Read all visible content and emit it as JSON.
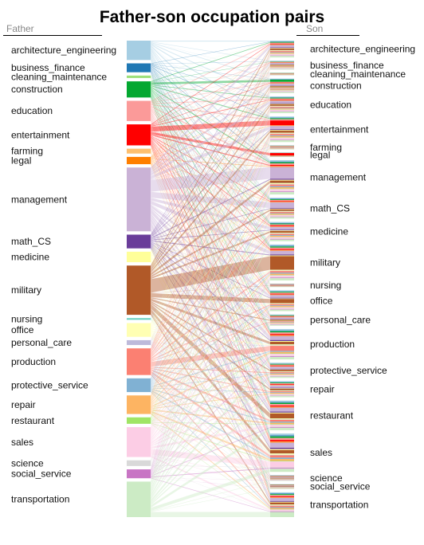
{
  "chart_data": {
    "type": "parallel_sets",
    "title": "Father-son occupation pairs",
    "left_axis_label": "Father",
    "right_axis_label": "Son",
    "categories": [
      {
        "name": "architecture_engineering",
        "color": "#a6cee3",
        "father": 24,
        "son": 21
      },
      {
        "name": "business_finance",
        "color": "#1f78b4",
        "father": 11,
        "son": 11
      },
      {
        "name": "cleaning_maintenance",
        "color": "#9de07a",
        "father": 3,
        "son": 3
      },
      {
        "name": "construction",
        "color": "#03a831",
        "father": 20,
        "son": 18
      },
      {
        "name": "education",
        "color": "#fb9a99",
        "father": 25,
        "son": 21
      },
      {
        "name": "entertainment",
        "color": "#ff0000",
        "father": 26,
        "son": 32
      },
      {
        "name": "farming",
        "color": "#fdbf6f",
        "father": 6,
        "son": 5
      },
      {
        "name": "legal",
        "color": "#ff7f00",
        "father": 9,
        "son": 5
      },
      {
        "name": "management",
        "color": "#cab2d6",
        "father": 79,
        "son": 43
      },
      {
        "name": "math_CS",
        "color": "#6a3d9a",
        "father": 17,
        "son": 26
      },
      {
        "name": "medicine",
        "color": "#ffff99",
        "father": 13,
        "son": 24
      },
      {
        "name": "military",
        "color": "#b15928",
        "father": 61,
        "son": 45
      },
      {
        "name": "nursing",
        "color": "#66d1c0",
        "father": 2,
        "son": 4
      },
      {
        "name": "office",
        "color": "#ffffb3",
        "father": 17,
        "son": 26
      },
      {
        "name": "personal_care",
        "color": "#bebada",
        "father": 6,
        "son": 14
      },
      {
        "name": "production",
        "color": "#fb8072",
        "father": 33,
        "son": 38
      },
      {
        "name": "protective_service",
        "color": "#80b1d3",
        "father": 17,
        "son": 19
      },
      {
        "name": "repair",
        "color": "#fdb462",
        "father": 23,
        "son": 20
      },
      {
        "name": "restaurant",
        "color": "#a0e565",
        "father": 8,
        "son": 37
      },
      {
        "name": "sales",
        "color": "#fccde5",
        "father": 37,
        "son": 48
      },
      {
        "name": "science",
        "color": "#d9d9d9",
        "father": 7,
        "son": 7
      },
      {
        "name": "social_service",
        "color": "#c875c4",
        "father": 11,
        "son": 6
      },
      {
        "name": "transportation",
        "color": "#ccebc5",
        "father": 44,
        "son": 31
      }
    ],
    "notable_flows": [
      {
        "father": "military",
        "son": "military",
        "count": 14
      },
      {
        "father": "management",
        "son": "management",
        "count": 10
      },
      {
        "father": "entertainment",
        "son": "entertainment",
        "count": 5
      },
      {
        "father": "construction",
        "son": "construction",
        "count": 2
      },
      {
        "father": "entertainment",
        "son": "legal",
        "count": 3
      },
      {
        "father": "management",
        "son": "math_CS",
        "count": 4
      },
      {
        "father": "sales",
        "son": "sales",
        "count": 4
      },
      {
        "father": "production",
        "son": "production",
        "count": 4
      },
      {
        "father": "transportation",
        "son": "transportation",
        "count": 4
      },
      {
        "father": "military",
        "son": "restaurant",
        "count": 3
      },
      {
        "father": "military",
        "son": "office",
        "count": 3
      }
    ]
  }
}
